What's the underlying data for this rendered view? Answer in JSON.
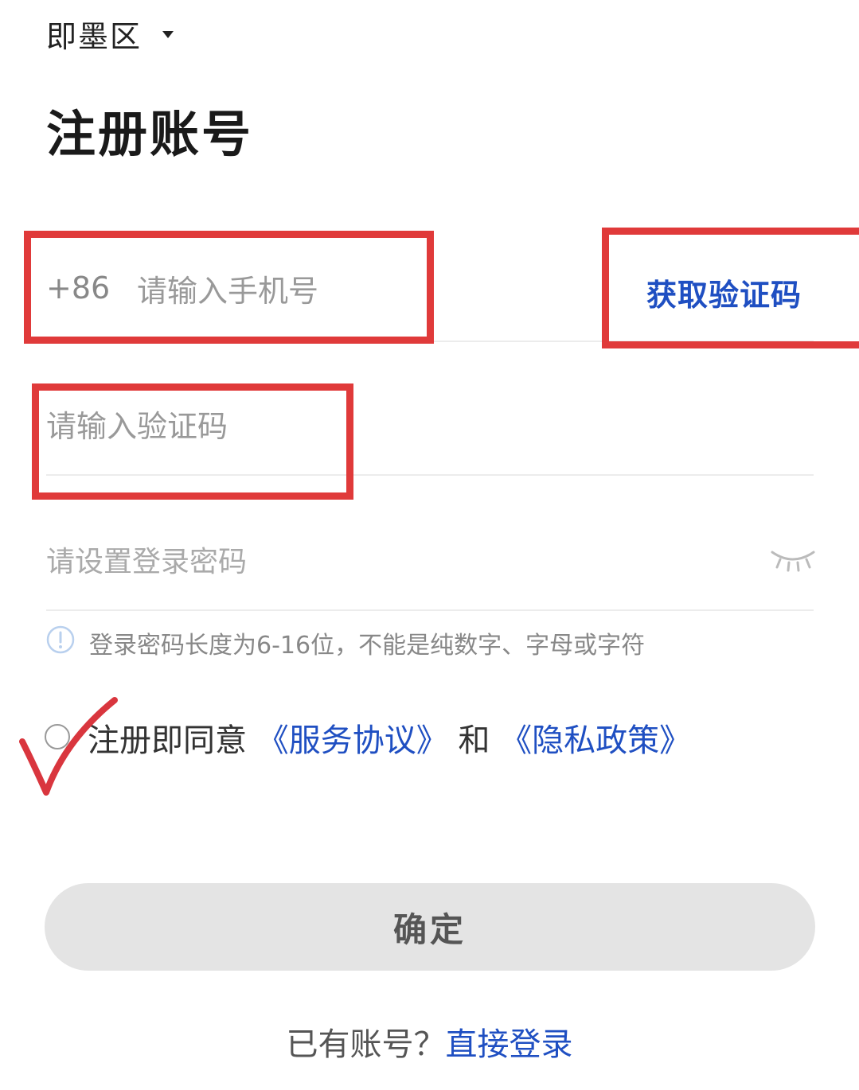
{
  "region": {
    "label": "即墨区"
  },
  "page": {
    "title": "注册账号"
  },
  "phone": {
    "country_code": "+86",
    "placeholder": "请输入手机号"
  },
  "get_code": {
    "label": "获取验证码"
  },
  "verify": {
    "placeholder": "请输入验证码"
  },
  "password": {
    "placeholder": "请设置登录密码",
    "hint": "登录密码长度为6-16位，不能是纯数字、字母或字符"
  },
  "agreement": {
    "prefix": "注册即同意",
    "service_link": "《服务协议》",
    "and": "和",
    "privacy_link": "《隐私政策》"
  },
  "confirm": {
    "label": "确定"
  },
  "login": {
    "prompt": "已有账号？",
    "link": "直接登录"
  },
  "colors": {
    "link": "#1f4fc2",
    "annotation": "#e03a3a",
    "button_bg": "#e4e4e4"
  },
  "icons": [
    "caret-down-icon",
    "eye-closed-icon",
    "info-icon",
    "check-mark-icon"
  ]
}
